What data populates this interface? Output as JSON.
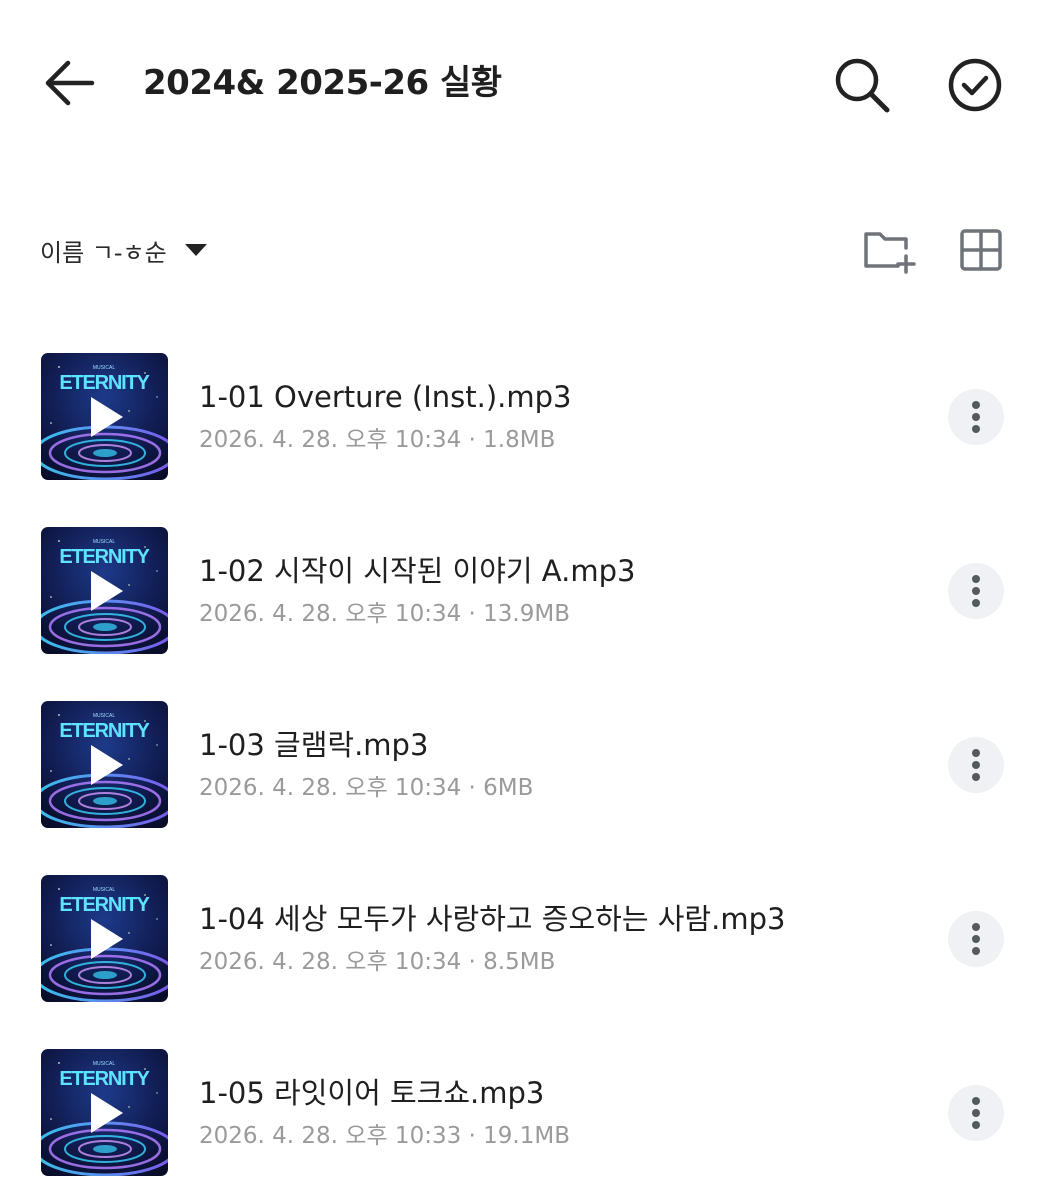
{
  "header": {
    "title": "2024& 2025-26 실황",
    "icons": {
      "back": "arrow-left-icon",
      "search": "search-icon",
      "select": "check-circle-icon"
    }
  },
  "toolbar": {
    "sort_label": "이름 ㄱ-ㅎ순",
    "icons": {
      "sort": "caret-down-icon",
      "new_folder": "folder-plus-icon",
      "view": "grid-view-icon"
    }
  },
  "thumbnail": {
    "title": "ETERNITY",
    "colors": {
      "bg_dark": "#0b1235",
      "accent_cyan": "#3ad7ff",
      "accent_purple": "#8a5cff"
    }
  },
  "files": [
    {
      "name": "1-01 Overture (Inst.).mp3",
      "meta": "2026. 4. 28. 오후 10:34 · 1.8MB"
    },
    {
      "name": "1-02 시작이 시작된 이야기 A.mp3",
      "meta": "2026. 4. 28. 오후 10:34 · 13.9MB"
    },
    {
      "name": "1-03 글램락.mp3",
      "meta": "2026. 4. 28. 오후 10:34 · 6MB"
    },
    {
      "name": "1-04 세상 모두가 사랑하고 증오하는 사람.mp3",
      "meta": "2026. 4. 28. 오후 10:34 · 8.5MB"
    },
    {
      "name": "1-05 라잇이어 토크쇼.mp3",
      "meta": "2026. 4. 28. 오후 10:33 · 19.1MB"
    }
  ]
}
